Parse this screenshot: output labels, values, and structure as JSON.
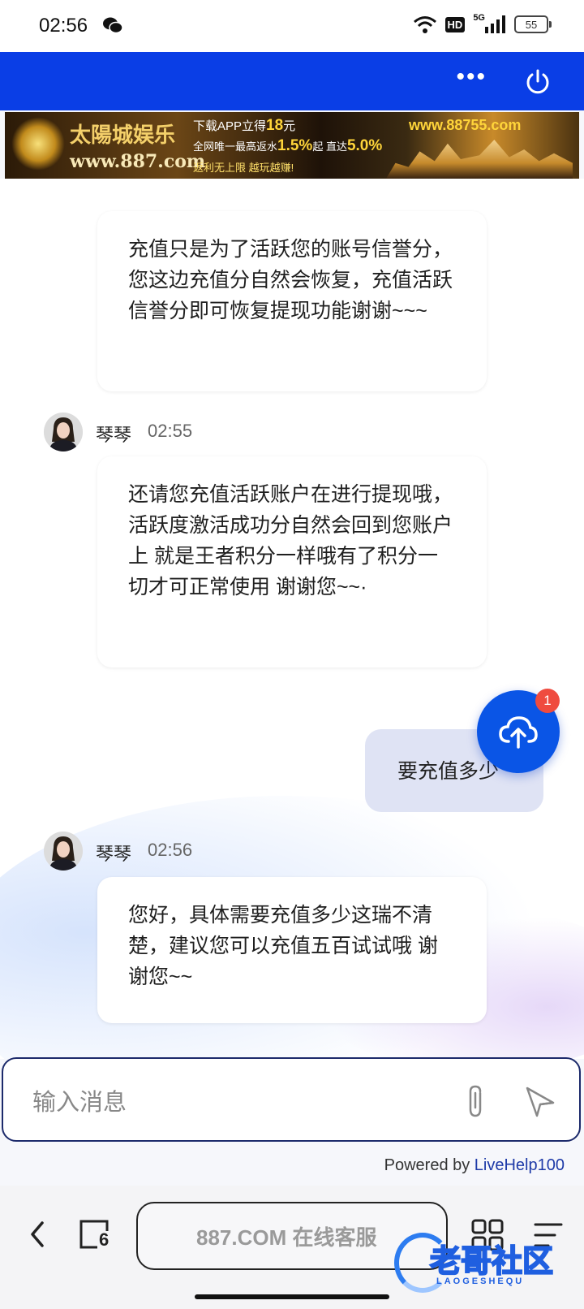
{
  "status_bar": {
    "time": "02:56",
    "hd": "HD",
    "network": "5G",
    "battery": "55"
  },
  "header": {
    "more_icon": "more-dots-icon",
    "power_icon": "power-icon"
  },
  "banner": {
    "brand": "太陽城娱乐",
    "brand_url": "www.887.com",
    "line1_prefix": "下载APP立得",
    "line1_amount": "18",
    "line1_suffix": "元",
    "line2_prefix": "全网唯一最高返水",
    "line2_value1": "1.5%",
    "line2_mid": "起 直达",
    "line2_value2": "5.0%",
    "line3": "返利无上限 越玩越赚!",
    "site": "www.88755.com"
  },
  "messages": [
    {
      "text": "充值只是为了活跃您的账号信誉分，您这边充值分自然会恢复，充值活跃信誉分即可恢复提现功能谢谢~~~"
    },
    {
      "sender": "琴琴",
      "time": "02:55",
      "text": "还请您充值活跃账户在进行提现哦，活跃度激活成功分自然会回到您账户上 就是王者积分一样哦有了积分一切才可正常使用 谢谢您~~·"
    },
    {
      "from_me": true,
      "text": "要充值多少"
    },
    {
      "sender": "琴琴",
      "time": "02:56",
      "text": "您好，具体需要充值多少这瑞不清楚，建议您可以充值五百试试哦 谢谢您~~"
    }
  ],
  "upload_fab": {
    "icon": "cloud-upload-icon",
    "badge": "1"
  },
  "input": {
    "placeholder": "输入消息",
    "attach_icon": "paperclip-icon",
    "send_icon": "send-icon"
  },
  "footer": {
    "powered_prefix": "Powered by ",
    "powered_brand": "LiveHelp100"
  },
  "browser_nav": {
    "url_title": "887.COM 在线客服",
    "tab_count": "6",
    "icons": [
      "back-arrow-icon",
      "tabs-icon",
      "grid-icon",
      "menu-icon"
    ]
  },
  "watermark": {
    "text": "老哥社区",
    "sub": "LAOGESHEQU"
  }
}
